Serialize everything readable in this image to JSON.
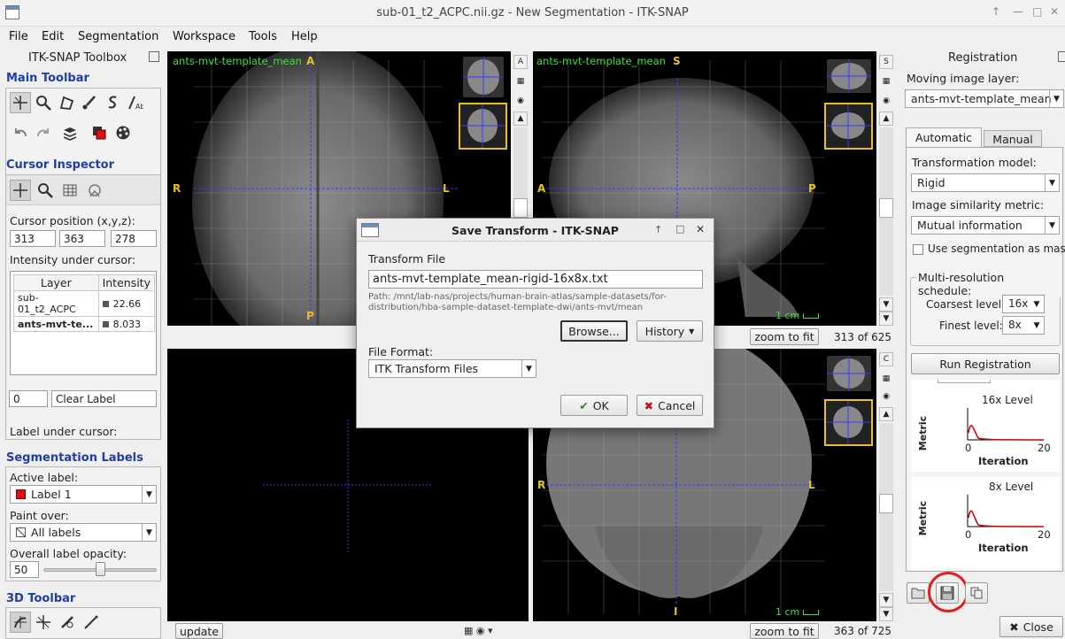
{
  "window": {
    "title": "sub-01_t2_ACPC.nii.gz - New Segmentation - ITK-SNAP"
  },
  "menu": [
    "File",
    "Edit",
    "Segmentation",
    "Workspace",
    "Tools",
    "Help"
  ],
  "toolbox": {
    "title": "ITK-SNAP Toolbox",
    "main_toolbar": "Main Toolbar",
    "cursor_inspector": "Cursor Inspector",
    "cursor_position_label": "Cursor position (x,y,z):",
    "cursor_x": "313",
    "cursor_y": "363",
    "cursor_z": "278",
    "intensity_label": "Intensity under cursor:",
    "table_headers": [
      "Layer",
      "Intensity"
    ],
    "rows": [
      {
        "layer": "sub-01_t2_ACPC",
        "value": "22.66"
      },
      {
        "layer": "ants-mvt-te...",
        "value": "8.033"
      }
    ],
    "label_under_cursor": "Label under cursor:",
    "label_id": "0",
    "label_name": "Clear Label",
    "seg_labels": "Segmentation Labels",
    "active_label_caption": "Active label:",
    "active_label": "Label 1",
    "paint_over_caption": "Paint over:",
    "paint_over": "All labels",
    "opacity_caption": "Overall label opacity:",
    "opacity": "50",
    "opacity_level": 0.5,
    "toolbar3d": "3D Toolbar"
  },
  "viewers": {
    "layer_name": "ants-mvt-template_mean",
    "axial": {
      "top": "A",
      "bottom": "P",
      "left": "R",
      "right": "L"
    },
    "sagittal": {
      "top": "S",
      "left": "A",
      "right": "P"
    },
    "coronal": {
      "left": "R",
      "right": "L",
      "bottom": "I"
    },
    "scale": "1 cm",
    "zoom_to_fit": "zoom to fit",
    "slice_top": "313 of 625",
    "slice_bottom": "363 of 725",
    "update": "update"
  },
  "registration": {
    "title": "Registration",
    "moving_caption": "Moving image layer:",
    "moving_layer": "ants-mvt-template_mean",
    "tab_auto": "Automatic",
    "tab_manual": "Manual",
    "transform_caption": "Transformation model:",
    "transform": "Rigid",
    "similarity_caption": "Image similarity metric:",
    "similarity": "Mutual information",
    "use_seg_mask": "Use segmentation as mask",
    "multires_caption": "Multi-resolution schedule:",
    "coarsest_caption": "Coarsest level:",
    "coarsest": "16x",
    "finest_caption": "Finest level:",
    "finest": "8x",
    "run_button": "Run Registration",
    "plots": [
      {
        "title": "16x Level",
        "ylabel": "Metric",
        "xlabel": "Iteration",
        "x_min": "0",
        "x_max": "20"
      },
      {
        "title": "8x Level",
        "ylabel": "Metric",
        "xlabel": "Iteration",
        "x_min": "0",
        "x_max": "20"
      }
    ],
    "close": "Close"
  },
  "dialog": {
    "title": "Save Transform - ITK-SNAP",
    "file_caption": "Transform File",
    "file_value": "ants-mvt-template_mean-rigid-16x8x.txt",
    "path_line1": "Path: /mnt/lab-nas/projects/human-brain-atlas/sample-datasets/for-",
    "path_line2": "distribution/hba-sample-dataset-template-dwi/ants-mvt/mean",
    "browse": "Browse...",
    "history": "History",
    "format_caption": "File Format:",
    "format_value": "ITK Transform Files",
    "ok": "OK",
    "cancel": "Cancel"
  },
  "colors": {
    "section_title": "#1f3ea6",
    "orientation": "#e8c020",
    "layer_label": "#3be53b",
    "crosshair": "#3a3aff",
    "highlight_circle": "#e02020"
  }
}
